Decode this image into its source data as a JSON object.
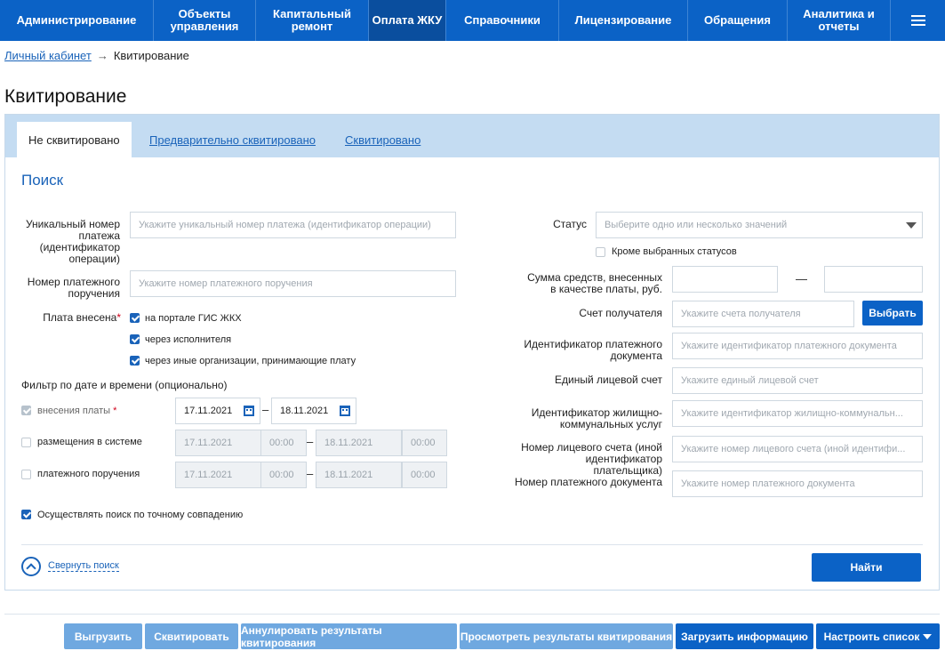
{
  "nav": {
    "items": [
      "Администрирование",
      "Объекты управления",
      "Капитальный ремонт",
      "Оплата ЖКУ",
      "Справочники",
      "Лицензирование",
      "Обращения",
      "Аналитика и отчеты"
    ],
    "active": "Оплата ЖКУ",
    "menu_icon": "hamburger-icon"
  },
  "breadcrumb": {
    "home": "Личный кабинет",
    "separator": "→",
    "current": "Квитирование"
  },
  "page_title": "Квитирование",
  "tabs": [
    "Не сквитировано",
    "Предварительно сквитировано",
    "Сквитировано"
  ],
  "search": {
    "title": "Поиск",
    "left": {
      "payment_id_label": "Уникальный номер платежа (идентификатор операции)",
      "payment_id_placeholder": "Укажите уникальный номер платежа (идентификатор операции)",
      "order_number_label": "Номер платежного поручения",
      "order_number_placeholder": "Укажите номер платежного поручения",
      "paid_via_label": "Плата внесена",
      "paid_via_required": "*",
      "paid_via_options": [
        "на портале ГИС ЖКХ",
        "через исполнителя",
        "через иные организации, принимающие плату"
      ],
      "date_filter_title": "Фильтр по дате и времени (опционально)",
      "date_rows": [
        {
          "label": "внесения платы",
          "required": "*",
          "from": "17.11.2021",
          "to": "18.11.2021"
        },
        {
          "label": "размещения в системе",
          "from": "17.11.2021",
          "from_time": "00:00",
          "to": "18.11.2021",
          "to_time": "00:00"
        },
        {
          "label": "платежного поручения",
          "from": "17.11.2021",
          "from_time": "00:00",
          "to": "18.11.2021",
          "to_time": "00:00"
        }
      ],
      "date_dash": "–",
      "exact_match_label": "Осуществлять поиск по точному совпадению"
    },
    "right": {
      "status_label": "Статус",
      "status_placeholder": "Выберите одно или несколько значений",
      "except_statuses_label": "Кроме выбранных статусов",
      "sum_label": "Сумма средств, внесенных в качестве платы, руб.",
      "sum_dash": "—",
      "recipient_account_label": "Счет получателя",
      "recipient_account_placeholder": "Укажите счета получателя",
      "select_button": "Выбрать",
      "payment_doc_id_label": "Идентификатор платежного документа",
      "payment_doc_id_placeholder": "Укажите идентификатор платежного документа",
      "unified_account_label": "Единый лицевой счет",
      "unified_account_placeholder": "Укажите единый лицевой счет",
      "housing_service_id_label": "Идентификатор жилищно-коммунальных услуг",
      "housing_service_id_placeholder": "Укажите идентификатор жилищно-коммунальн...",
      "personal_account_label": "Номер лицевого счета (иной идентификатор плательщика)",
      "personal_account_placeholder": "Укажите номер лицевого счета (иной идентифи...",
      "payment_doc_number_label": "Номер платежного документа",
      "payment_doc_number_placeholder": "Укажите номер платежного документа"
    },
    "collapse_link": "Свернуть поиск",
    "find_button": "Найти"
  },
  "actions": [
    "Выгрузить",
    "Сквитировать",
    "Аннулировать результаты квитирования",
    "Просмотреть результаты квитирования",
    "Загрузить информацию",
    "Настроить список"
  ],
  "colors": {
    "primary": "#0b62c6",
    "tabs_bg": "#c4dcf2",
    "disabled_button": "#6fa8e0"
  }
}
